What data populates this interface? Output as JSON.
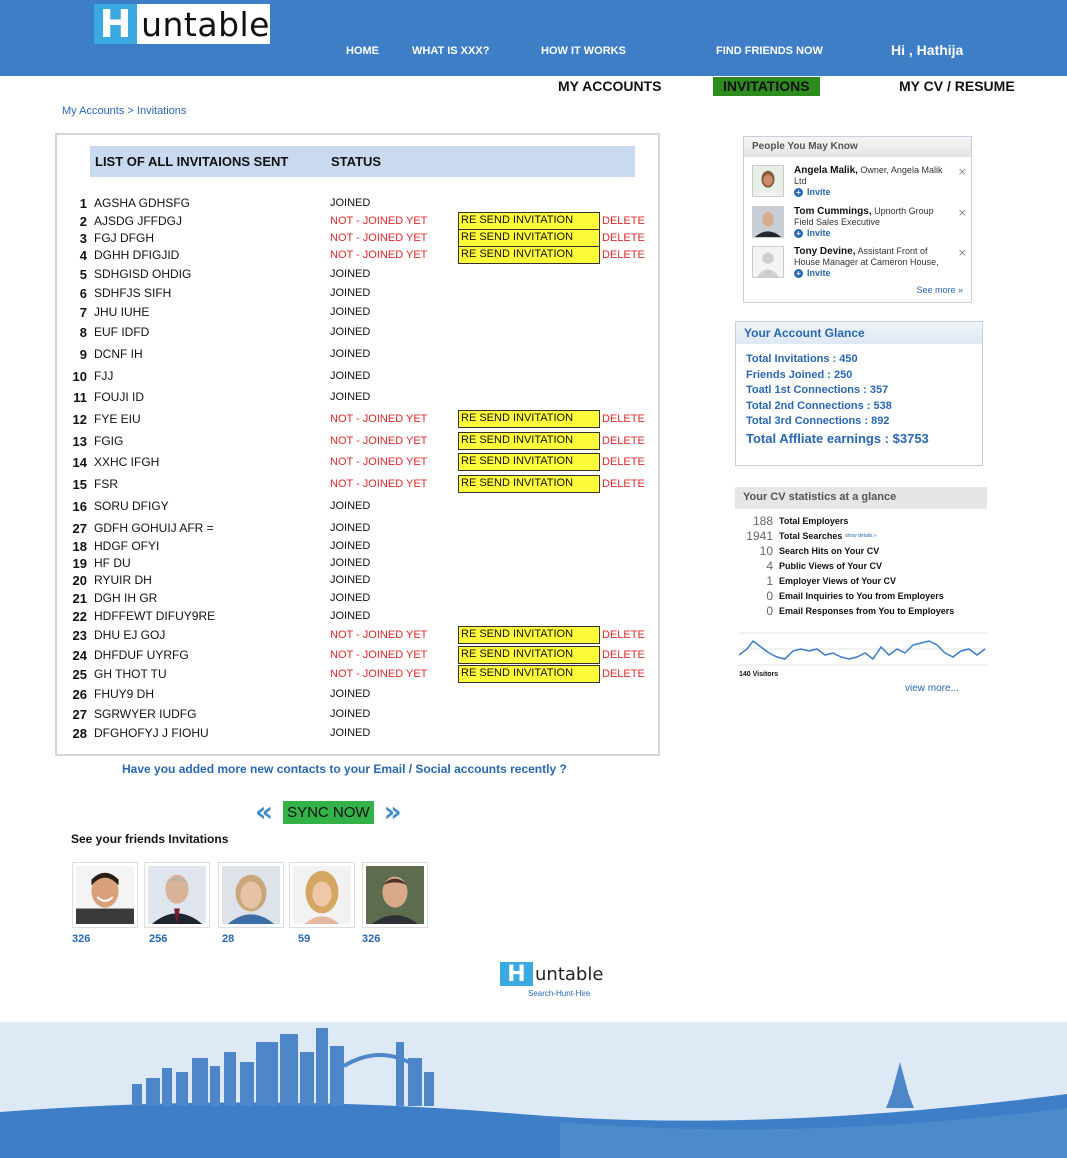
{
  "brand": {
    "logo_letter": "H",
    "logo_text": "untable",
    "tagline": "Search-Hunt-Hire"
  },
  "nav": [
    "HOME",
    "WHAT IS XXX?",
    "HOW IT WORKS",
    "FIND FRIENDS NOW"
  ],
  "greeting": "Hi , Hathija",
  "tabs": {
    "my_accounts": "MY ACCOUNTS",
    "invitations": "INVITATIONS",
    "my_cv": "MY CV / RESUME"
  },
  "breadcrumb": "My Accounts > Invitations",
  "invitations": {
    "header_list": "LIST OF ALL INVITAIONS SENT",
    "header_status": "STATUS",
    "resend_label": "RE SEND INVITATION",
    "delete_label": "DELETE",
    "rows": [
      {
        "num": "1",
        "name": "AGSHA GDHSFG",
        "status": "JOINED",
        "pending": false
      },
      {
        "num": "2",
        "name": "AJSDG JFFDGJ",
        "status": "NOT - JOINED YET",
        "pending": true
      },
      {
        "num": "3",
        "name": "FGJ DFGH",
        "status": "NOT - JOINED YET",
        "pending": true
      },
      {
        "num": "4",
        "name": "DGHH DFIGJID",
        "status": "NOT - JOINED YET",
        "pending": true
      },
      {
        "num": "5",
        "name": "SDHGISD OHDIG",
        "status": "JOINED",
        "pending": false
      },
      {
        "num": "6",
        "name": "SDHFJS SIFH",
        "status": "JOINED",
        "pending": false
      },
      {
        "num": "7",
        "name": "JHU IUHE",
        "status": "JOINED",
        "pending": false
      },
      {
        "num": "8",
        "name": "EUF  IDFD",
        "status": "JOINED",
        "pending": false
      },
      {
        "num": "9",
        "name": "DCNF IH",
        "status": "JOINED",
        "pending": false
      },
      {
        "num": "10",
        "name": "FJJ",
        "status": "JOINED",
        "pending": false
      },
      {
        "num": "11",
        "name": "FOUJI ID",
        "status": "JOINED",
        "pending": false
      },
      {
        "num": "12",
        "name": "FYE  EIU",
        "status": "NOT - JOINED YET",
        "pending": true
      },
      {
        "num": "13",
        "name": "FGIG",
        "status": "NOT - JOINED YET",
        "pending": true
      },
      {
        "num": "14",
        "name": "XXHC IFGH",
        "status": "NOT - JOINED YET",
        "pending": true
      },
      {
        "num": "15",
        "name": "FSR",
        "status": "NOT - JOINED YET",
        "pending": true
      },
      {
        "num": "16",
        "name": "SORU  DFIGY",
        "status": "JOINED",
        "pending": false
      },
      {
        "num": "27",
        "name": "GDFH GOHUIJ AFR =",
        "status": "JOINED",
        "pending": false
      },
      {
        "num": "18",
        "name": "HDGF OFYI",
        "status": "JOINED",
        "pending": false
      },
      {
        "num": "19",
        "name": "HF DU",
        "status": "JOINED",
        "pending": false
      },
      {
        "num": "20",
        "name": "RYUIR  DH",
        "status": "JOINED",
        "pending": false
      },
      {
        "num": "21",
        "name": "DGH IH GR",
        "status": "JOINED",
        "pending": false
      },
      {
        "num": "22",
        "name": "HDFFEWT DIFUY9RE",
        "status": "JOINED",
        "pending": false
      },
      {
        "num": "23",
        "name": "DHU EJ GOJ",
        "status": "NOT - JOINED YET",
        "pending": true
      },
      {
        "num": "24",
        "name": "DHFDUF UYRFG",
        "status": "NOT - JOINED YET",
        "pending": true
      },
      {
        "num": "25",
        "name": "GH THOT TU",
        "status": "NOT - JOINED YET",
        "pending": true
      },
      {
        "num": "26",
        "name": "FHUY9 DH",
        "status": "JOINED",
        "pending": false
      },
      {
        "num": "27",
        "name": "SGRWYER IUDFG",
        "status": "JOINED",
        "pending": false
      },
      {
        "num": "28",
        "name": "DFGHOFYJ J FIOHU",
        "status": "JOINED",
        "pending": false
      }
    ]
  },
  "contacts_question": "Have you added more new contacts to your Email / Social accounts recently ?",
  "sync": {
    "left": "«",
    "label": "SYNC NOW",
    "right": "»"
  },
  "friends": {
    "title": "See your friends Invitations",
    "counts": [
      "326",
      "256",
      "28",
      "59",
      "326"
    ]
  },
  "people_you_may_know": {
    "title": "People You May Know",
    "invite_label": "Invite",
    "people": [
      {
        "name": "Angela Malik,",
        "detail": " Owner, Angela Malik Ltd"
      },
      {
        "name": "Tom Cummings,",
        "detail": " Upnorth Group Field Sales Executive"
      },
      {
        "name": "Tony Devine,",
        "detail": " Assistant Front of House Manager at Cameron House,"
      }
    ],
    "see_more": "See more »"
  },
  "account_glance": {
    "title": "Your Account Glance",
    "lines": [
      "Total Invitations        : 450",
      "Friends Joined           : 250",
      "Toatl 1st Connections  : 357",
      "Total 2nd Connections  : 538",
      "Total 3rd Connections : 892"
    ],
    "earnings": "Total Affliate earnings : $3753"
  },
  "cv_stats": {
    "title": "Your CV statistics at a glance",
    "rows": [
      {
        "count": "188",
        "label": "Total Employers"
      },
      {
        "count": "1941",
        "label": "Total Searches"
      },
      {
        "count": "10",
        "label": "Search Hits on Your CV"
      },
      {
        "count": "4",
        "label": "Public Views of Your CV"
      },
      {
        "count": "1",
        "label": "Employer Views of Your CV"
      },
      {
        "count": "0",
        "label": "Email Inquiries to You from Employers"
      },
      {
        "count": "0",
        "label": "Email Responses from You to Employers"
      }
    ],
    "show_details": "show details »",
    "visitors": "140",
    "visitors_label": "Visitors",
    "view_more": "view more..."
  },
  "colors": {
    "header": "#3e7ec7",
    "accent_green": "#2e8b1e",
    "link": "#2767b4",
    "resend": "#fefc3a",
    "pending": "#e0282a"
  }
}
